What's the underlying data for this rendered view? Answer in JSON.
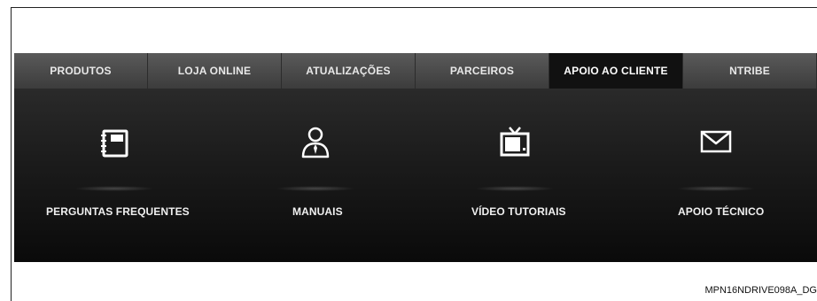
{
  "nav": {
    "items": [
      {
        "label": "PRODUTOS"
      },
      {
        "label": "LOJA ONLINE"
      },
      {
        "label": "ATUALIZAÇÕES"
      },
      {
        "label": "PARCEIROS"
      },
      {
        "label": "APOIO AO CLIENTE",
        "active": true
      },
      {
        "label": "NTRIBE"
      }
    ]
  },
  "panel": {
    "tiles": [
      {
        "label": "PERGUNTAS FREQUENTES",
        "icon": "notebook-icon"
      },
      {
        "label": "MANUAIS",
        "icon": "person-icon"
      },
      {
        "label": "VÍDEO TUTORIAIS",
        "icon": "tv-icon"
      },
      {
        "label": "APOIO TÉCNICO",
        "icon": "envelope-icon"
      }
    ]
  },
  "figure_code": "MPN16NDRIVE098A_DG",
  "colors": {
    "nav_bg": "#4a4a4a",
    "active_tab": "#111111",
    "panel_bg": "#1c1c1c",
    "text": "#f0f0f0"
  }
}
